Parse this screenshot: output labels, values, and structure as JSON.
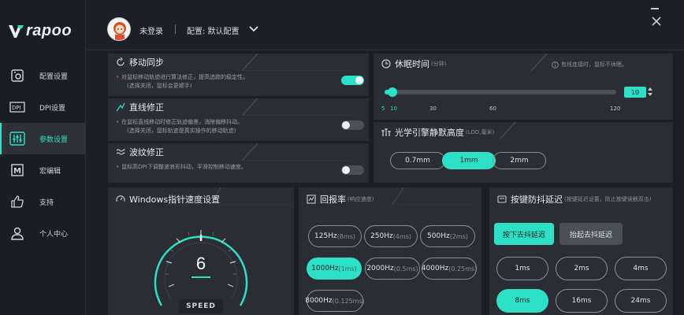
{
  "brand": {
    "logo_text": "rapoo"
  },
  "sidebar": {
    "items": [
      {
        "label": "配置设置",
        "icon": "config-icon"
      },
      {
        "label": "DPI设置",
        "icon": "dpi-icon"
      },
      {
        "label": "参数设置",
        "icon": "params-icon",
        "active": true
      },
      {
        "label": "宏编辑",
        "icon": "macro-icon"
      },
      {
        "label": "支持",
        "icon": "thumbs-up-icon"
      },
      {
        "label": "个人中心",
        "icon": "user-icon"
      }
    ]
  },
  "header": {
    "user_status": "未登录",
    "profile": "配置: 默认配置"
  },
  "motion_sync": {
    "title": "移动同步",
    "desc1": "对鼠标移动轨迹进行算法修正，提高追踪的稳定性。",
    "desc2": "(选择关闭，鼠标会更顺手)",
    "enabled": true
  },
  "angle_snap": {
    "title": "直线修正",
    "desc1": "在鼠标直线移动时修正轨迹偏差，消除偏移抖动。",
    "desc2": "(选择关闭，鼠标轨迹是真实操作的移动轨迹)",
    "enabled": false
  },
  "ripple": {
    "title": "波纹修正",
    "desc1": "鼠标高DPI下调整波浪形抖动，平滑控制移动速度。",
    "enabled": false
  },
  "sleep": {
    "title": "休眠时间",
    "unit": "(分钟)",
    "note": "有线连接时，鼠标不休眠。",
    "value": "10",
    "ticks": [
      "5",
      "10",
      "30",
      "60",
      "120"
    ]
  },
  "lod": {
    "title": "光学引擎静默高度",
    "unit": "(LOD,毫米)",
    "options": [
      "0.7mm",
      "1mm",
      "2mm"
    ],
    "selected": "1mm"
  },
  "pointer_speed": {
    "title": "Windows指针速度设置",
    "value": "6",
    "label": "SPEED"
  },
  "polling": {
    "title": "回报率",
    "sub": "(响应速度)",
    "options": [
      {
        "hz": "125Hz",
        "ms": "(8ms)"
      },
      {
        "hz": "250Hz",
        "ms": "(4ms)"
      },
      {
        "hz": "500Hz",
        "ms": "(2ms)"
      },
      {
        "hz": "1000Hz",
        "ms": "(1ms)"
      },
      {
        "hz": "2000Hz",
        "ms": "(0.5ms)"
      },
      {
        "hz": "4000Hz",
        "ms": "(0.25ms)"
      },
      {
        "hz": "8000Hz",
        "ms": "(0.125ms)"
      }
    ],
    "selected": "1000Hz"
  },
  "debounce": {
    "title": "按键防抖延迟",
    "sub": "(按键延迟设置，防止按键误触双击)",
    "press_label": "按下去抖延迟",
    "release_label": "抬起去抖延迟",
    "options": [
      "1ms",
      "2ms",
      "4ms",
      "8ms",
      "16ms",
      "24ms"
    ],
    "selected": "8ms"
  },
  "colors": {
    "accent": "#2ce0c6",
    "panel": "#2a2d33",
    "bg": "#1c1f25"
  }
}
